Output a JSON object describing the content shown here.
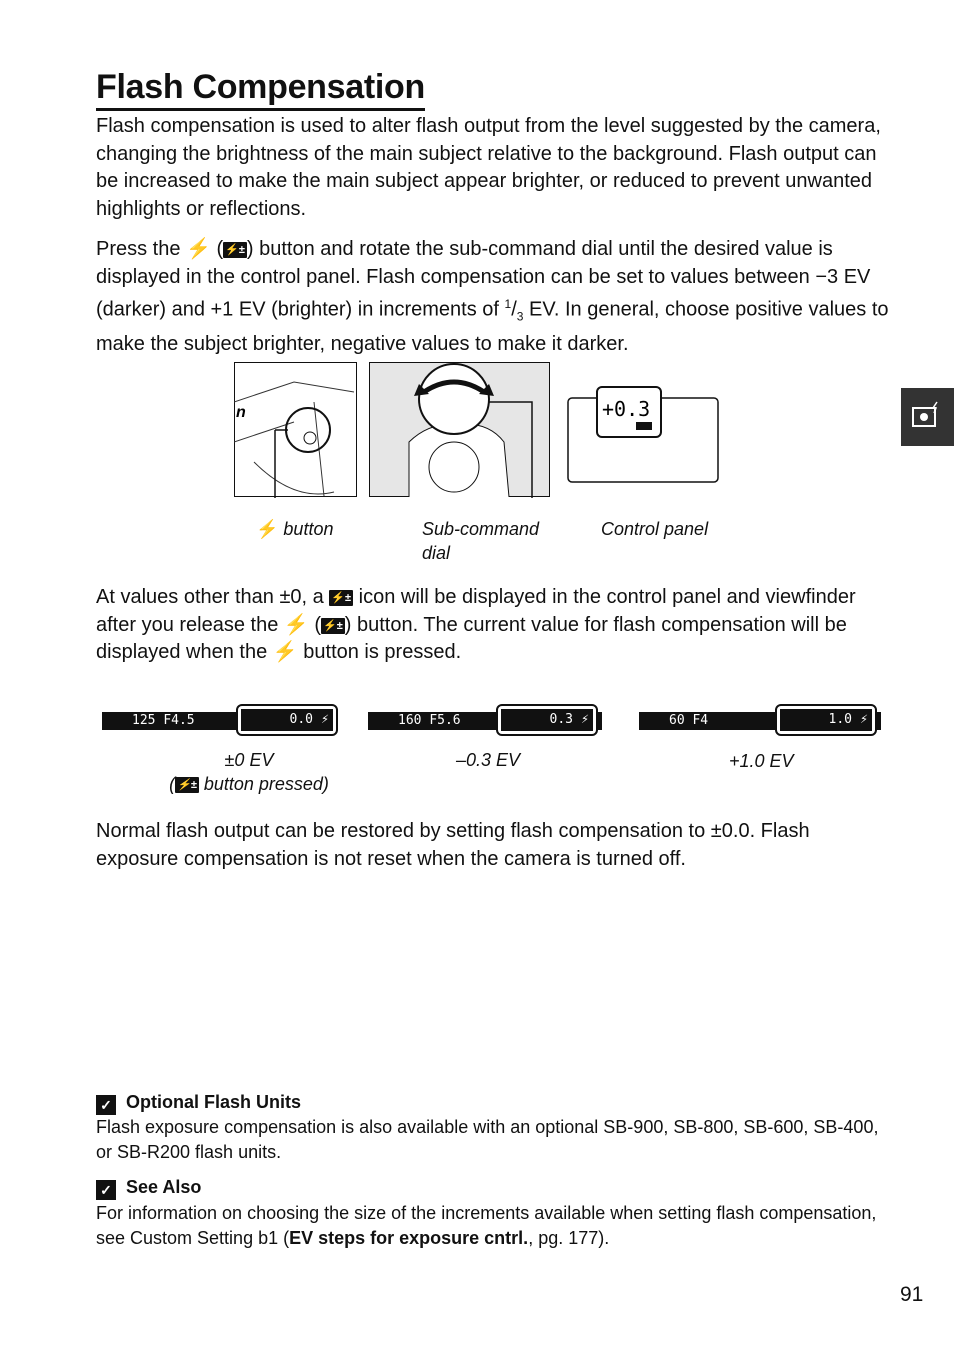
{
  "title": "Flash Compensation",
  "para1": "Flash compensation is used to alter flash output from the level suggested by the camera, changing the brightness of the main subject relative to the background. Flash output can be increased to make the main subject appear brighter, or reduced to prevent unwanted highlights or reflections.",
  "para2": {
    "a": "Press the ",
    "b": " (",
    "c": ") button and rotate the sub-command dial until the desired value is displayed in the control panel.  Flash compensation can be set to values between −3 EV (darker) and +1 EV (brighter) in increments of ",
    "num": "1",
    "den": "3",
    "d": " EV.  In general, choose positive values to make the subject brighter, negative values to make it darker."
  },
  "flash_icon": "⚡",
  "fc_icon": "⚡±",
  "captions": {
    "button": " button",
    "dial": "Sub-command dial",
    "panel": "Control panel"
  },
  "control_panel_value": "+0.3",
  "para3": {
    "a": "At values other than ±0, a ",
    "b": " icon will be displayed in the control panel and viewfinder after you release the ",
    "c": " (",
    "d": ") button.  The current value for flash compensation will be displayed when the ",
    "e": " button is pressed."
  },
  "viewfinder": [
    {
      "shutter": "125",
      "aperture": "F4.5",
      "value": "0.0",
      "caption": "±0 EV",
      "caption2": " button pressed)"
    },
    {
      "shutter": "160",
      "aperture": "F5.6",
      "value": "0.3",
      "caption": "–0.3 EV"
    },
    {
      "shutter": "60",
      "aperture": "F4",
      "value": "1.0",
      "caption": "+1.0 EV"
    }
  ],
  "para4": "Normal flash output can be restored by setting flash compensation to ±0.0.  Flash exposure compensation is not reset when the camera is turned off.",
  "notes": [
    {
      "icon": "check-icon",
      "title": "Optional Flash Units",
      "text": "Flash exposure compensation is also available with an optional SB-900, SB-800, SB-600, SB-400, or SB-R200 flash units."
    },
    {
      "icon": "check-icon",
      "title": "See Also",
      "text_a": "For information on choosing the size of the increments available when setting flash compensation, see Custom Setting b1 (",
      "text_b": "EV steps for exposure cntrl.",
      "text_c": ", pg. 177)."
    }
  ],
  "page_number": "91",
  "chapter_tab_icon": "camera-flash-icon"
}
